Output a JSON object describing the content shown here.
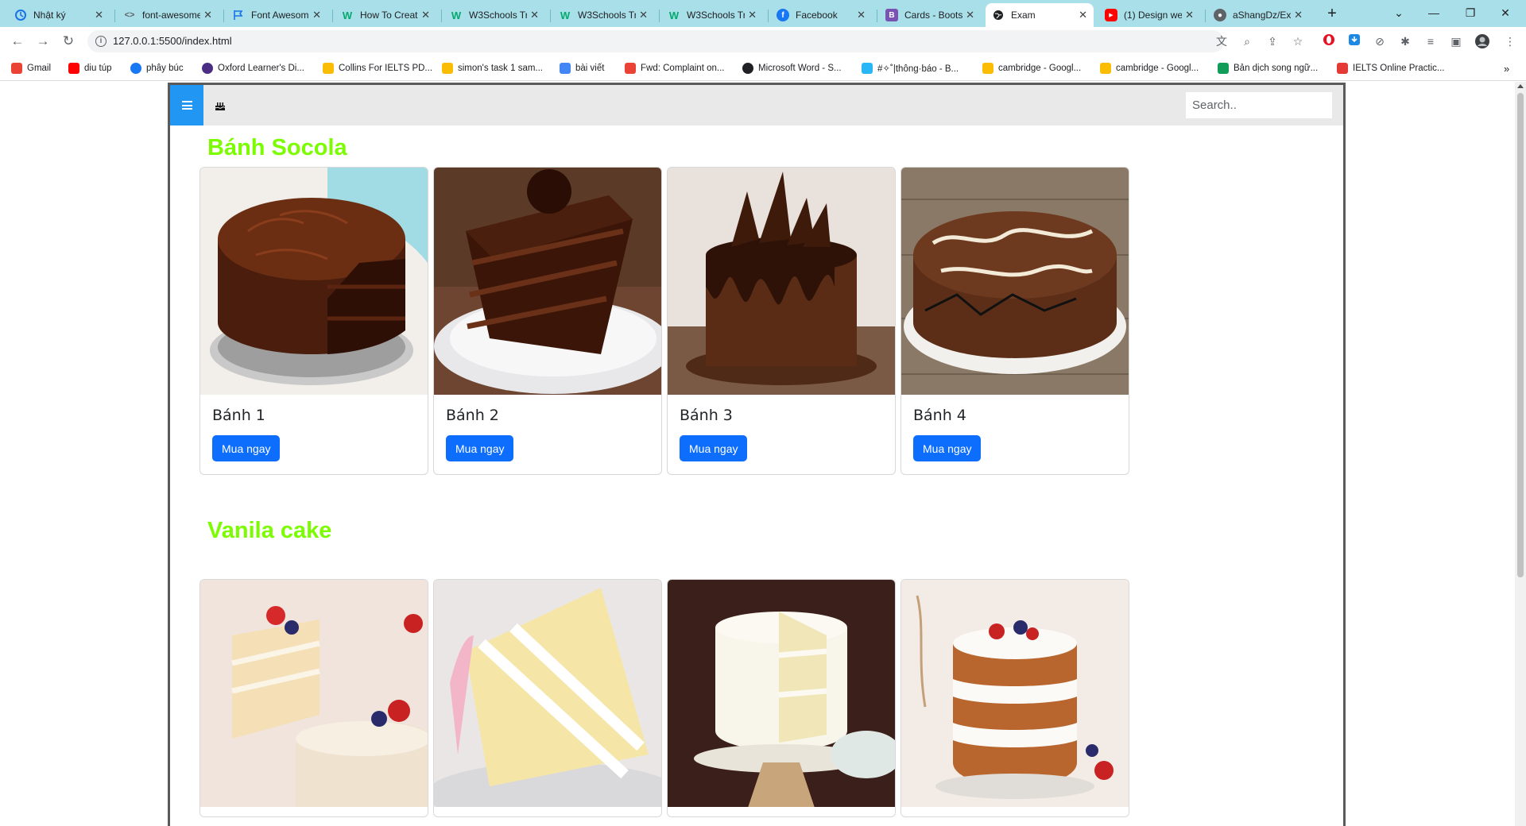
{
  "browser": {
    "tabs": [
      {
        "title": "Nhật ký",
        "favicon_color": "#1a73e8",
        "active": false
      },
      {
        "title": "font-awesome",
        "favicon_color": "#5f6368",
        "active": false
      },
      {
        "title": "Font Awesome",
        "favicon_color": "#1a73e8",
        "active": false
      },
      {
        "title": "How To Creat",
        "favicon_color": "#04aa6d",
        "active": false
      },
      {
        "title": "W3Schools Tr",
        "favicon_color": "#04aa6d",
        "active": false
      },
      {
        "title": "W3Schools Tr",
        "favicon_color": "#04aa6d",
        "active": false
      },
      {
        "title": "W3Schools Tr",
        "favicon_color": "#04aa6d",
        "active": false
      },
      {
        "title": "Facebook",
        "favicon_color": "#1877f2",
        "active": false
      },
      {
        "title": "Cards - Boots",
        "favicon_color": "#7952b3",
        "active": false
      },
      {
        "title": "Exam",
        "favicon_color": "#202124",
        "active": true
      },
      {
        "title": "(1) Design we",
        "favicon_color": "#ff0000",
        "active": false
      },
      {
        "title": "aShangDz/Ex",
        "favicon_color": "#5f6368",
        "active": false
      }
    ],
    "url": "127.0.0.1:5500/index.html",
    "bookmarks": [
      {
        "label": "Gmail",
        "color": "#ea4335"
      },
      {
        "label": "diu túp",
        "color": "#ff0000"
      },
      {
        "label": "phây búc",
        "color": "#1877f2"
      },
      {
        "label": "Oxford Learner's Di...",
        "color": "#4b2e83"
      },
      {
        "label": "Collins For IELTS PD...",
        "color": "#fbbc04"
      },
      {
        "label": "simon's task 1 sam...",
        "color": "#fbbc04"
      },
      {
        "label": "bài viết",
        "color": "#4285f4"
      },
      {
        "label": "Fwd: Complaint on...",
        "color": "#ea4335"
      },
      {
        "label": "Microsoft Word - S...",
        "color": "#202124"
      },
      {
        "label": "#✧˚|thông·báo - B...",
        "color": "#29b6f6"
      },
      {
        "label": "cambridge - Googl...",
        "color": "#fbbc04"
      },
      {
        "label": "cambridge - Googl...",
        "color": "#fbbc04"
      },
      {
        "label": "Bản dịch song ngữ...",
        "color": "#0f9d58"
      },
      {
        "label": "IELTS Online Practic...",
        "color": "#e53935"
      }
    ]
  },
  "site": {
    "search_placeholder": "Search..",
    "sections": [
      {
        "title": "Bánh Socola",
        "cards": [
          {
            "name": "Bánh 1",
            "button": "Mua ngay",
            "image": "chocolate-cake-1"
          },
          {
            "name": "Bánh 2",
            "button": "Mua ngay",
            "image": "chocolate-cake-slice"
          },
          {
            "name": "Bánh 3",
            "button": "Mua ngay",
            "image": "chocolate-drip-cake"
          },
          {
            "name": "Bánh 4",
            "button": "Mua ngay",
            "image": "chocolate-skeleton-cake"
          }
        ]
      },
      {
        "title": "Vanila cake",
        "cards": [
          {
            "image": "vanilla-berry-cake"
          },
          {
            "image": "vanilla-cake-slice"
          },
          {
            "image": "white-layer-cake-stand"
          },
          {
            "image": "naked-berry-cake"
          }
        ]
      }
    ]
  }
}
